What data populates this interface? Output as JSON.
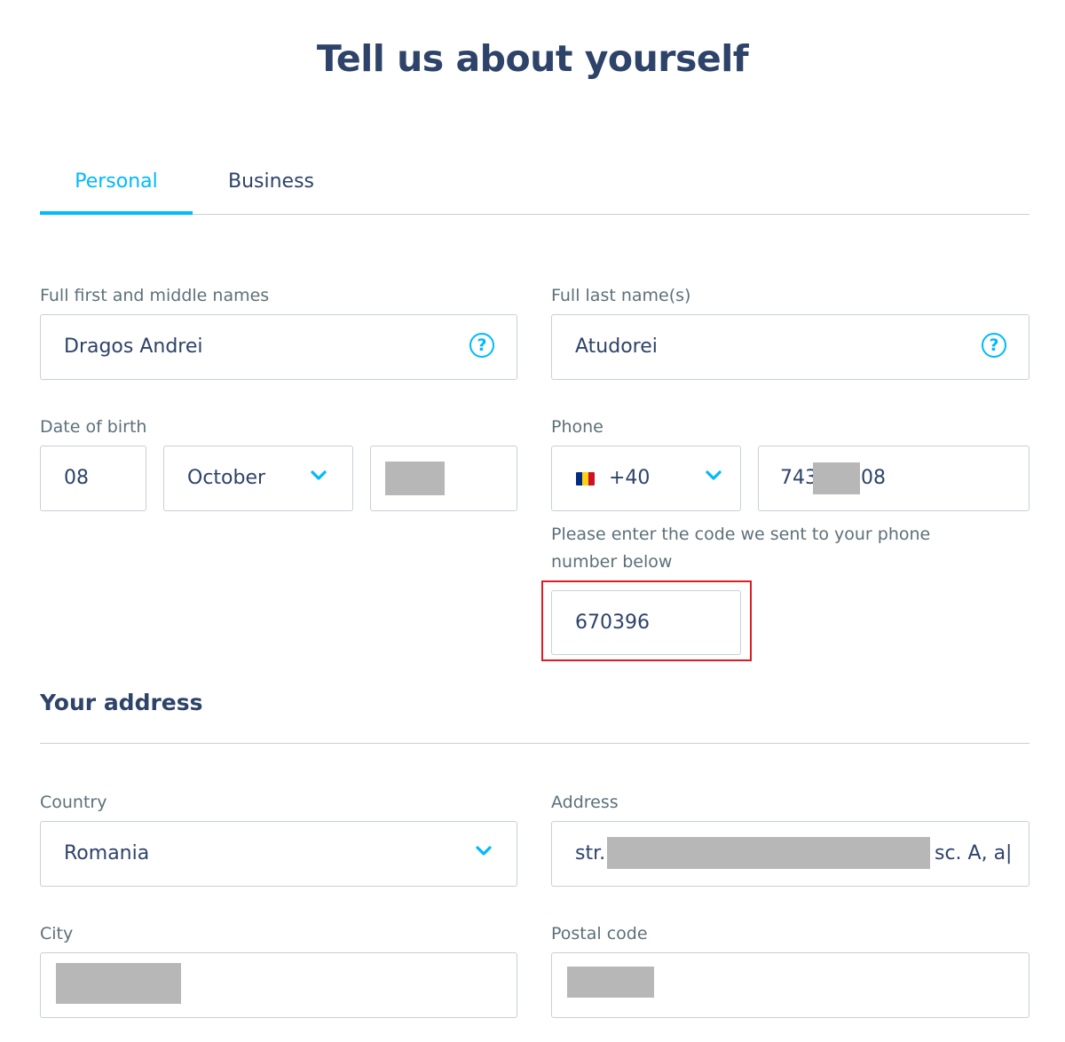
{
  "page": {
    "title": "Tell us about yourself"
  },
  "tabs": [
    {
      "label": "Personal",
      "active": true
    },
    {
      "label": "Business",
      "active": false
    }
  ],
  "personal": {
    "first_names": {
      "label": "Full first and middle names",
      "value": "Dragos Andrei",
      "icon": "help-circle-icon"
    },
    "last_names": {
      "label": "Full last name(s)",
      "value": "Atudorei",
      "icon": "help-circle-icon"
    },
    "dob": {
      "label": "Date of birth",
      "day": "08",
      "month": "October",
      "year_redacted": true
    },
    "phone": {
      "label": "Phone",
      "country_flag": "romania-flag-icon",
      "dial_code": "+40",
      "number_prefix": "743",
      "number_suffix": "08",
      "number_middle_redacted": true
    },
    "verification": {
      "hint_line1": "Please enter the code we sent to your phone",
      "hint_line2": "number below",
      "code": "670396"
    }
  },
  "address": {
    "section_title": "Your address",
    "country": {
      "label": "Country",
      "value": "Romania"
    },
    "street": {
      "label": "Address",
      "prefix": "str.",
      "suffix": "sc. A, a|"
    },
    "city": {
      "label": "City",
      "redacted": true
    },
    "postal_code": {
      "label": "Postal code",
      "redacted": true
    }
  },
  "colors": {
    "accent": "#00b9ff",
    "text": "#2e4369",
    "label": "#5d7079",
    "border": "#c9d0d6",
    "highlight": "#e01b24",
    "redaction": "#b7b7b7"
  }
}
